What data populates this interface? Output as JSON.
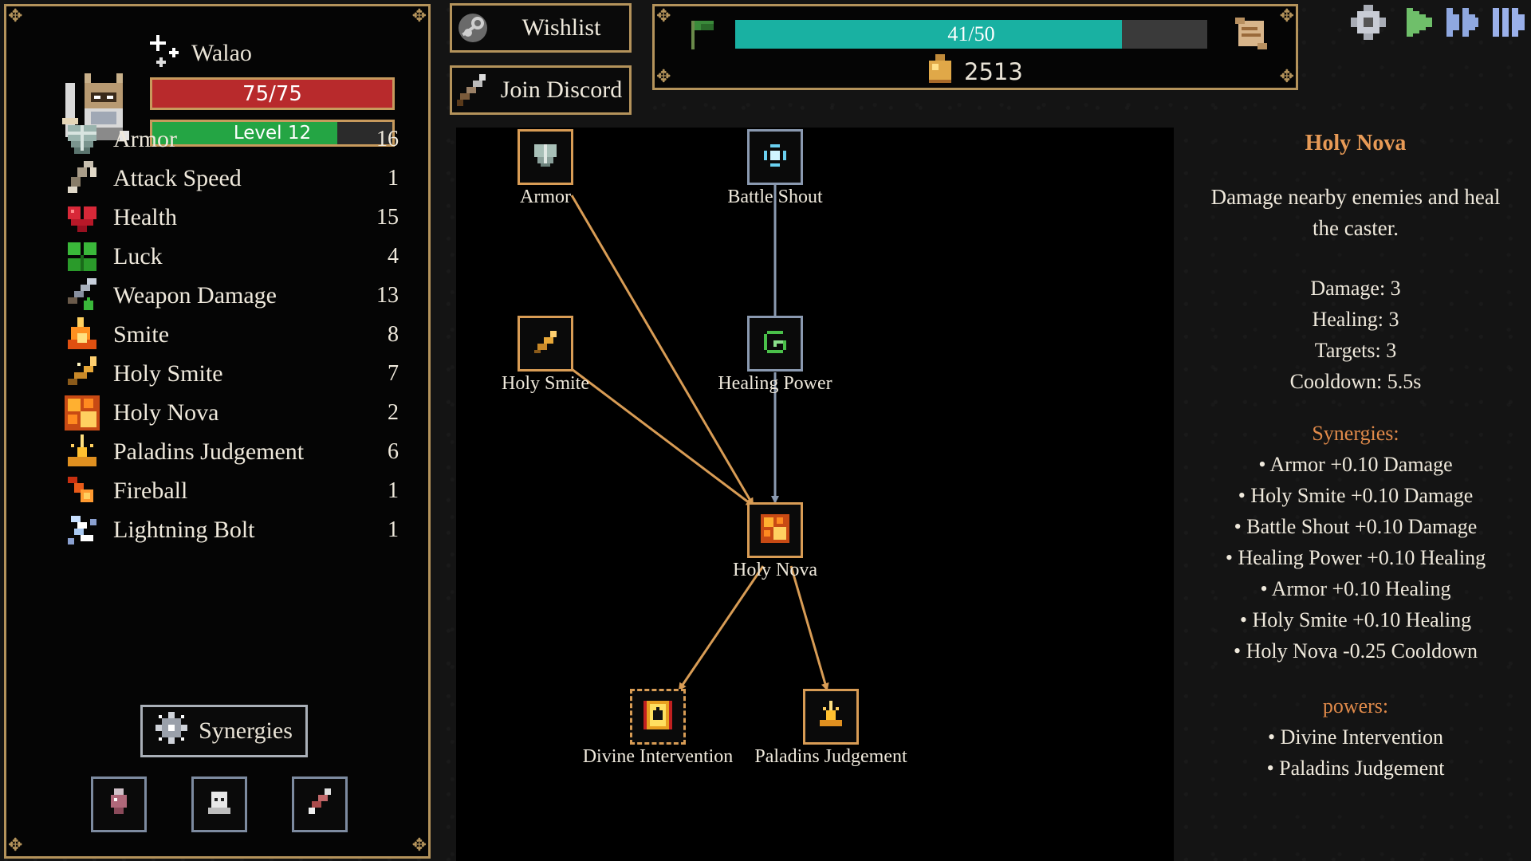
{
  "player": {
    "name": "Walao",
    "hp_text": "75/75",
    "hp_fraction": 1.0,
    "level_text": "Level 12",
    "level_fraction": 0.77
  },
  "stats": [
    {
      "icon": "shield-icon",
      "label": "Armor",
      "value": "16"
    },
    {
      "icon": "claw-icon",
      "label": "Attack Speed",
      "value": "1"
    },
    {
      "icon": "heart-icon",
      "label": "Health",
      "value": "15"
    },
    {
      "icon": "clover-icon",
      "label": "Luck",
      "value": "4"
    },
    {
      "icon": "sword-icon",
      "label": "Weapon Damage",
      "value": "13"
    },
    {
      "icon": "flame-icon",
      "label": "Smite",
      "value": "8"
    },
    {
      "icon": "holy-smite-icon",
      "label": "Holy Smite",
      "value": "7"
    },
    {
      "icon": "holy-nova-icon",
      "label": "Holy Nova",
      "value": "2"
    },
    {
      "icon": "judgement-icon",
      "label": "Paladins Judgement",
      "value": "6"
    },
    {
      "icon": "fireball-icon",
      "label": "Fireball",
      "value": "1"
    },
    {
      "icon": "lightning-icon",
      "label": "Lightning Bolt",
      "value": "1"
    }
  ],
  "synergies_button": "Synergies",
  "buttons": {
    "wishlist": "Wishlist",
    "discord": "Join Discord"
  },
  "xp": {
    "text": "41/50",
    "fraction": 0.82
  },
  "gold": "2513",
  "tree": {
    "nodes": {
      "armor": "Armor",
      "battle_shout": "Battle Shout",
      "holy_smite": "Holy Smite",
      "healing_power": "Healing Power",
      "holy_nova": "Holy Nova",
      "divine_intervention": "Divine Intervention",
      "paladins_judgement": "Paladins Judgement"
    }
  },
  "detail": {
    "title": "Holy Nova",
    "description": "Damage nearby enemies and heal the caster.",
    "stats": [
      "Damage: 3",
      "Healing: 3",
      "Targets: 3",
      "Cooldown: 5.5s"
    ],
    "synergies_title": "Synergies:",
    "synergies": [
      "• Armor +0.10 Damage",
      "• Holy Smite +0.10 Damage",
      "• Battle Shout +0.10 Damage",
      "• Healing Power +0.10 Healing",
      "• Armor +0.10 Healing",
      "• Holy Smite +0.10 Healing",
      "• Holy Nova -0.25 Cooldown"
    ],
    "powers_title": "powers:",
    "powers": [
      "• Divine Intervention",
      "• Paladins Judgement"
    ]
  },
  "colors": {
    "frame": "#b4935b",
    "hp": "#b82a2c",
    "level": "#24a544",
    "xp": "#19b1a2",
    "highlight": "#e79a56",
    "orange_edge": "#d89c55",
    "blue_edge": "#8a99b0"
  }
}
